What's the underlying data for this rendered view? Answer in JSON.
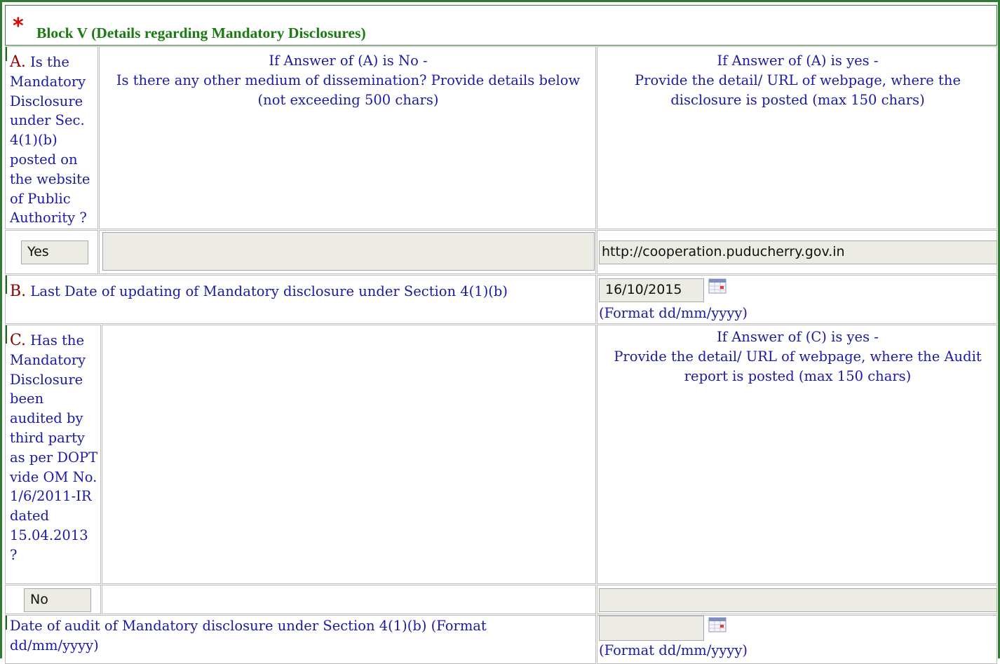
{
  "block": {
    "star": "*",
    "title": "Block V (Details regarding Mandatory Disclosures)"
  },
  "question_a": {
    "letter": "A.",
    "text": "Is the Mandatory Disclosure under Sec. 4(1)(b) posted on the website of Public Authority ?",
    "no_header": [
      "If Answer of (A) is No -",
      "Is there any other medium of dissemination? Provide details below",
      "(not exceeding 500 chars)"
    ],
    "yes_header": [
      "If Answer of (A) is yes -",
      "Provide the detail/ URL of webpage, where the",
      "disclosure is posted (max 150 chars)"
    ],
    "answer": "Yes",
    "other_medium_value": "",
    "url_value": "http://cooperation.puducherry.gov.in"
  },
  "question_b": {
    "letter": "B.",
    "text": "Last Date of updating of Mandatory disclosure under Section 4(1)(b)",
    "date_value": "16/10/2015",
    "format_hint": "(Format dd/mm/yyyy)",
    "calendar_icon": "calendar-icon"
  },
  "question_c": {
    "letter": "C.",
    "text": "Has the Mandatory Disclosure been audited by third party as per DOPT vide OM No. 1/6/2011-IR dated 15.04.2013 ?",
    "yes_header": [
      "If Answer of (C) is yes -",
      "Provide the detail/ URL of webpage, where the Audit",
      "report is posted (max 150 chars)"
    ],
    "answer": "No",
    "url_value": ""
  },
  "audit_date": {
    "text": "Date of audit of Mandatory disclosure under Section 4(1)(b) (Format dd/mm/yyyy)",
    "date_value": "",
    "format_hint": "(Format dd/mm/yyyy)"
  },
  "colors": {
    "border_green": "#2e7d32",
    "title_green": "#1b7a12",
    "star_red": "#e00000",
    "text_blue": "#1a1aa6",
    "letter_red": "#8b0000",
    "control_bg": "#ecebe4"
  }
}
